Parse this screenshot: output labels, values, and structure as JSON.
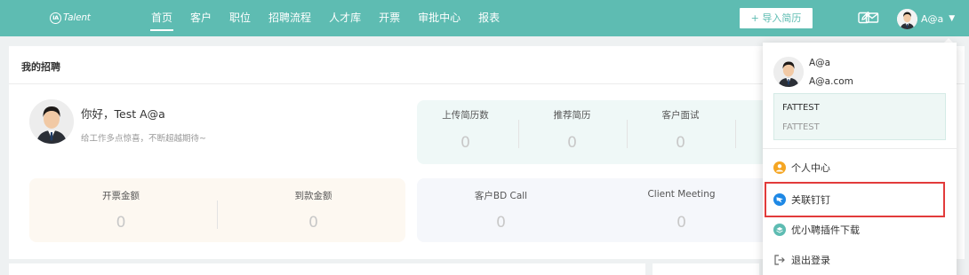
{
  "logo": {
    "mark": "IA",
    "text": "Talent"
  },
  "nav": {
    "items": [
      {
        "label": "首页",
        "active": true
      },
      {
        "label": "客户"
      },
      {
        "label": "职位"
      },
      {
        "label": "招聘流程"
      },
      {
        "label": "人才库"
      },
      {
        "label": "开票"
      },
      {
        "label": "审批中心"
      },
      {
        "label": "报表"
      }
    ],
    "import_label": "+ 导入简历",
    "user_name": "A@a"
  },
  "panel": {
    "title": "我的招聘",
    "greeting": "你好，Test A@a",
    "subtitle": "给工作多点惊喜，不断超越期待~",
    "stats_top": [
      {
        "label": "上传简历数",
        "value": "0"
      },
      {
        "label": "推荐简历",
        "value": "0"
      },
      {
        "label": "客户面试",
        "value": "0"
      }
    ],
    "stats_invoice": [
      {
        "label": "开票金额",
        "value": "0"
      },
      {
        "label": "到款金额",
        "value": "0"
      }
    ],
    "stats_bd": [
      {
        "label": "客户BD Call",
        "value": "0"
      },
      {
        "label": "Client Meeting",
        "value": "0"
      }
    ]
  },
  "dropdown": {
    "name": "A@a",
    "email": "A@a.com",
    "company_line1": "FATTEST",
    "company_line2": "FATTEST",
    "items": [
      {
        "label": "个人中心",
        "icon": "person-icon"
      },
      {
        "label": "关联钉钉",
        "icon": "dingtalk-icon"
      },
      {
        "label": "优小聘插件下载",
        "icon": "plugin-icon"
      },
      {
        "label": "退出登录",
        "icon": "logout-icon"
      }
    ]
  },
  "colors": {
    "brand": "#5ebcb2",
    "highlight_border": "#e23b3b",
    "orange_icon": "#f5a623",
    "ding_blue": "#1e88e5"
  }
}
